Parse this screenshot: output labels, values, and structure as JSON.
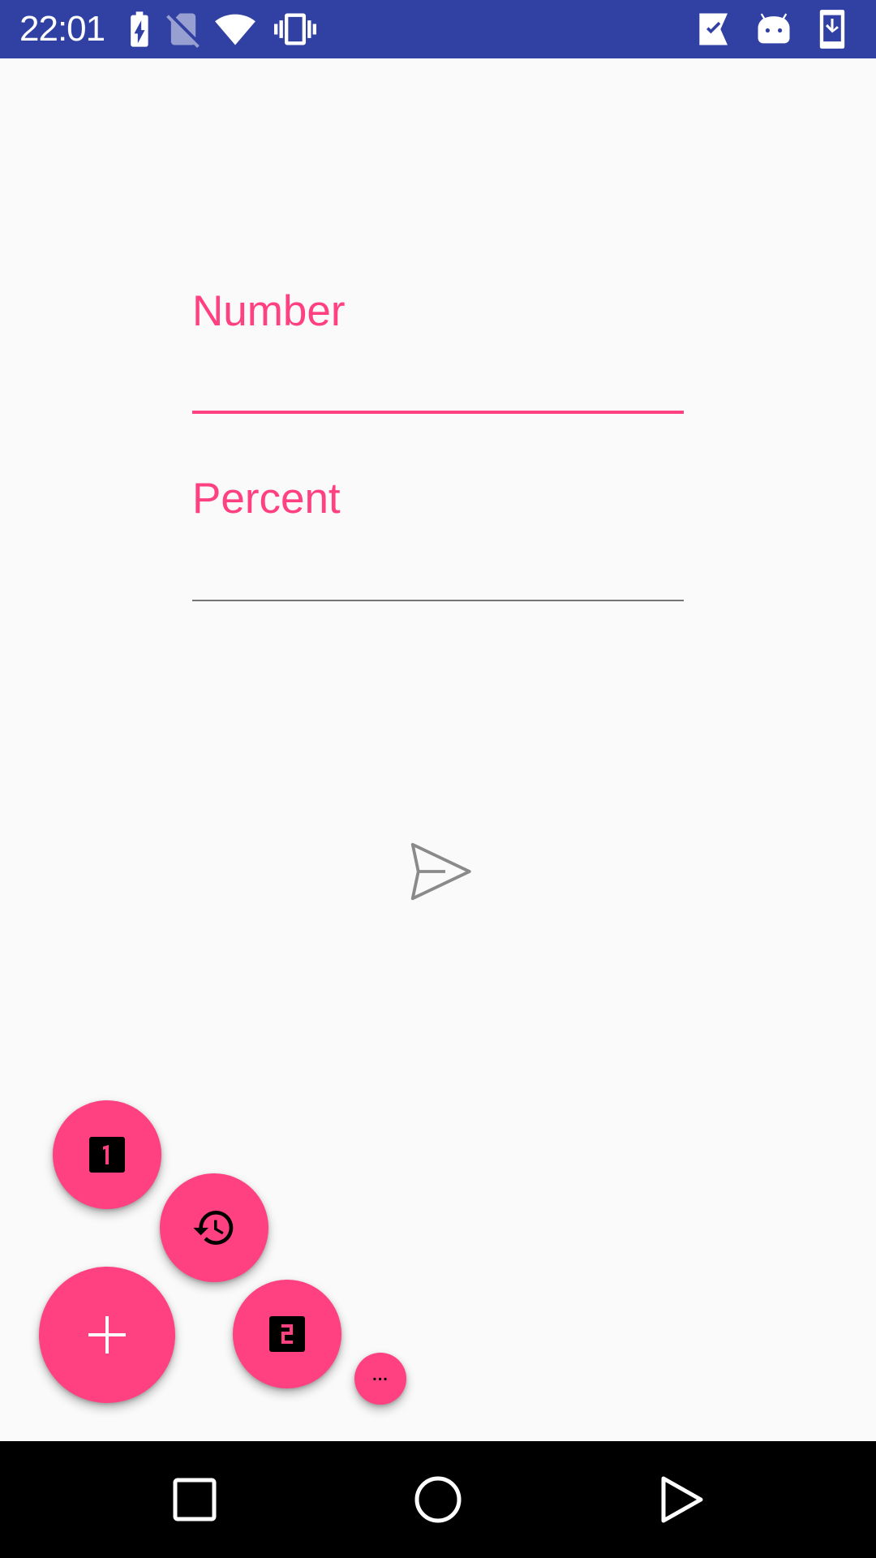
{
  "status_bar": {
    "time": "22:01",
    "color": "#3141a3",
    "icons": [
      "battery-charging-icon",
      "no-sim-icon",
      "wifi-icon",
      "vibrate-icon",
      "task-check-icon",
      "android-icon",
      "download-icon"
    ]
  },
  "form": {
    "number_label": "Number",
    "percent_label": "Percent"
  },
  "fabs": {
    "one_label": "1",
    "two_label": "2",
    "more_label": "..."
  },
  "colors": {
    "accent": "#ff4081",
    "background": "#fafafa",
    "underline_inactive": "#757575",
    "send_icon": "#8a8a8a"
  },
  "nav_bar": {
    "icons": [
      "recents-icon",
      "home-icon",
      "back-icon"
    ]
  }
}
